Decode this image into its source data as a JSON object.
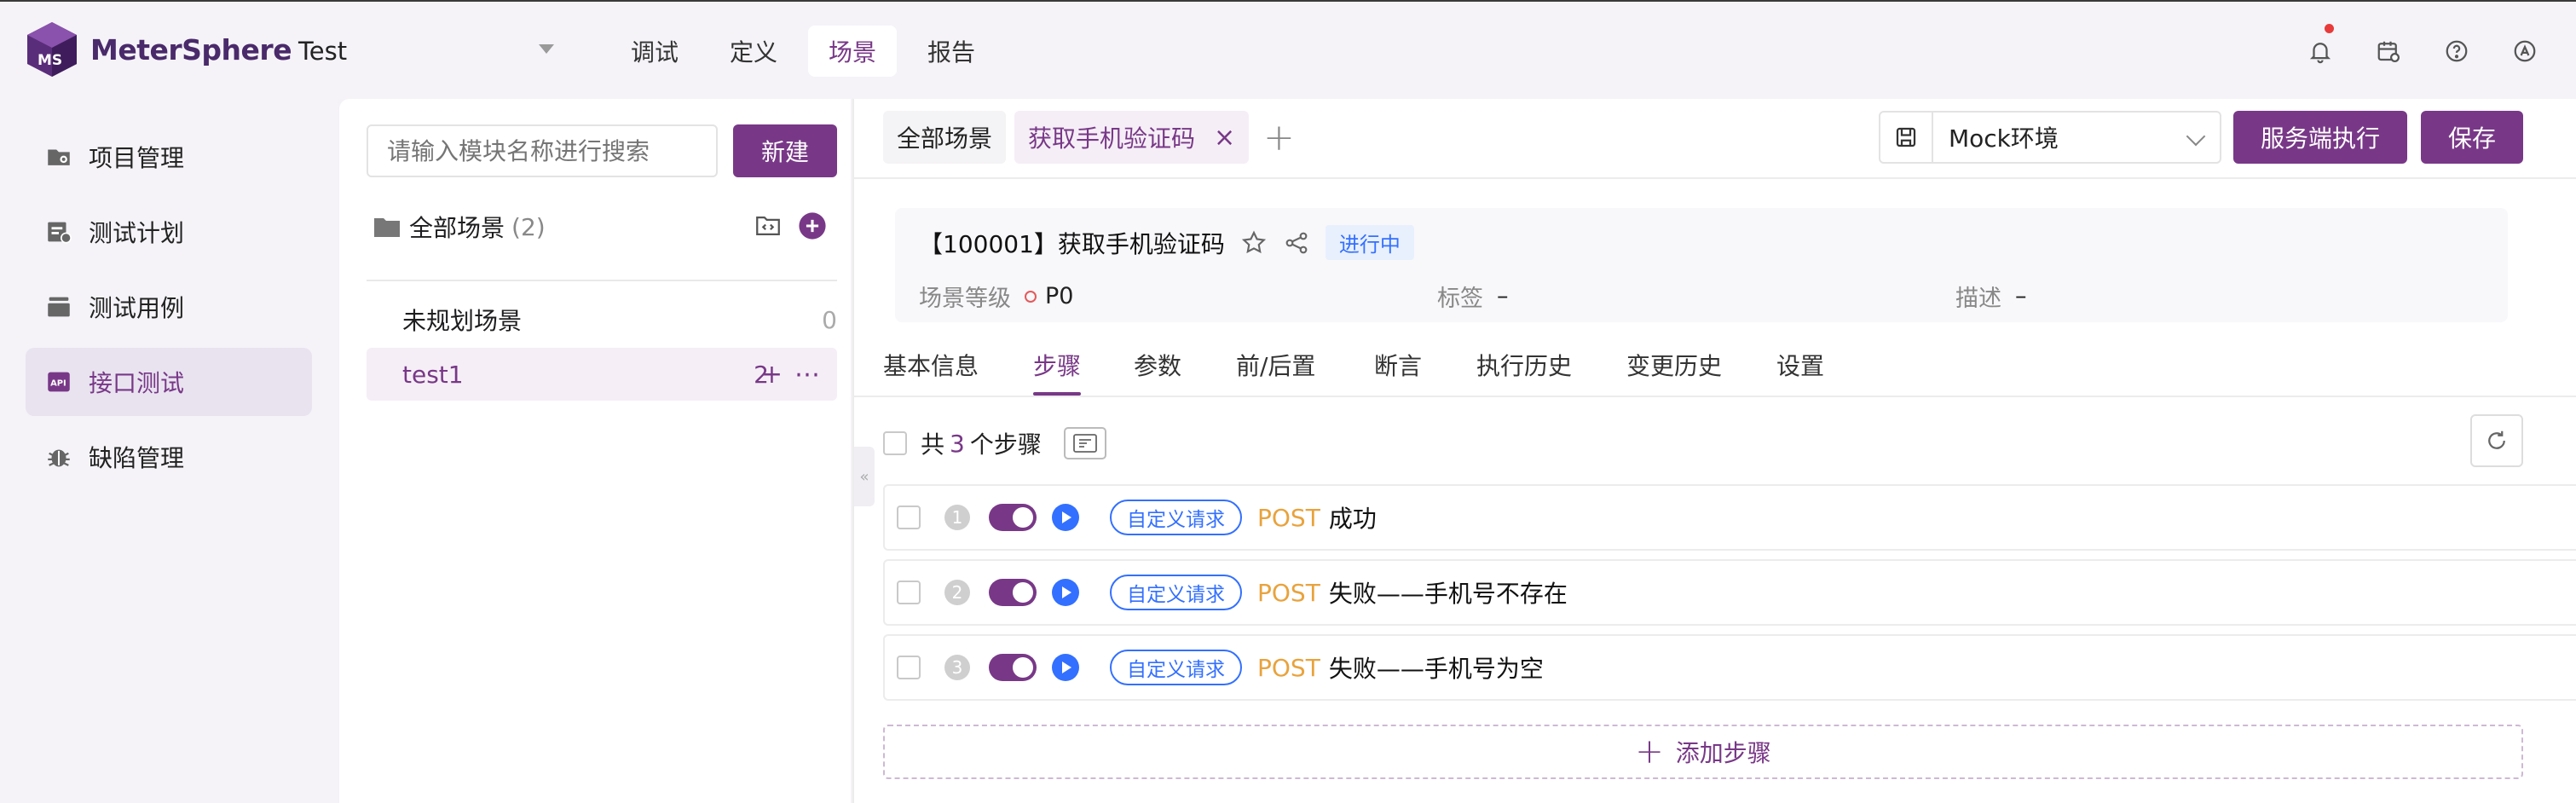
{
  "app": {
    "name": "MeterSphere",
    "project": "Test"
  },
  "topnav": [
    {
      "label": "调试",
      "active": false
    },
    {
      "label": "定义",
      "active": false
    },
    {
      "label": "场景",
      "active": true
    },
    {
      "label": "报告",
      "active": false
    }
  ],
  "top_icons": [
    "bell-icon",
    "calendar-icon",
    "help-icon",
    "language-icon"
  ],
  "sidebar": {
    "items": [
      {
        "label": "项目管理",
        "icon": "folder-settings-icon",
        "active": false
      },
      {
        "label": "测试计划",
        "icon": "calendar-plan-icon",
        "active": false
      },
      {
        "label": "测试用例",
        "icon": "stack-icon",
        "active": false
      },
      {
        "label": "接口测试",
        "icon": "api-icon",
        "active": true
      },
      {
        "label": "缺陷管理",
        "icon": "bug-icon",
        "active": false
      }
    ]
  },
  "modules": {
    "search_placeholder": "请输入模块名称进行搜索",
    "new_label": "新建",
    "root": {
      "label": "全部场景",
      "count": "(2)"
    },
    "items": [
      {
        "label": "未规划场景",
        "count": "0",
        "selected": false
      },
      {
        "label": "test1",
        "count": "2",
        "selected": true
      }
    ]
  },
  "tabs": {
    "all_label": "全部场景",
    "current_label": "获取手机验证码",
    "close_symbol": "×",
    "add_symbol": "+"
  },
  "toolbar": {
    "env": "Mock环境",
    "exec_label": "服务端执行",
    "save_label": "保存"
  },
  "scenario": {
    "title": "【100001】获取手机验证码",
    "status": "进行中",
    "level_label": "场景等级",
    "level_value": "P0",
    "tag_label": "标签",
    "tag_value": "–",
    "desc_label": "描述",
    "desc_value": "–"
  },
  "detail_tabs": [
    {
      "label": "基本信息",
      "active": false
    },
    {
      "label": "步骤",
      "active": true
    },
    {
      "label": "参数",
      "active": false
    },
    {
      "label": "前/后置",
      "active": false
    },
    {
      "label": "断言",
      "active": false
    },
    {
      "label": "执行历史",
      "active": false
    },
    {
      "label": "变更历史",
      "active": false
    },
    {
      "label": "设置",
      "active": false
    }
  ],
  "steps": {
    "prefix": "共",
    "count": "3",
    "suffix": "个步骤",
    "add_label": "添加步骤",
    "items": [
      {
        "num": "1",
        "type": "自定义请求",
        "method": "POST",
        "name": "成功"
      },
      {
        "num": "2",
        "type": "自定义请求",
        "method": "POST",
        "name": "失败——手机号不存在"
      },
      {
        "num": "3",
        "type": "自定义请求",
        "method": "POST",
        "name": "失败——手机号为空"
      }
    ]
  },
  "colors": {
    "brand": "#783887",
    "blue": "#3370ff",
    "method": "#e8a33d"
  }
}
